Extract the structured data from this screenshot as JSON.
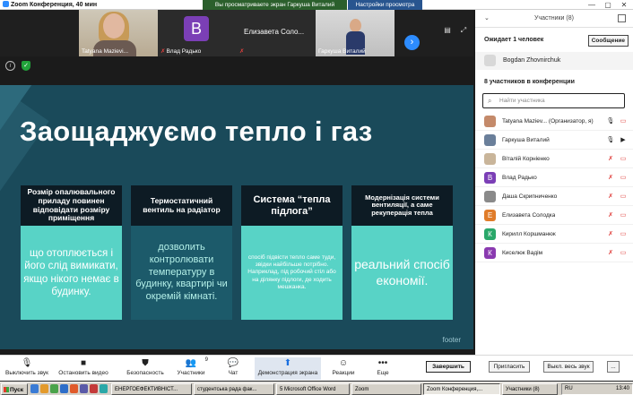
{
  "window": {
    "title": "Zoom Конференция, 40 мин",
    "share_banner": "Вы просматриваете экран Гаркуша Виталий",
    "view_options": "Настройки просмотра",
    "controls": [
      "—",
      "▢",
      "✕"
    ]
  },
  "video_strip": {
    "tiles": [
      {
        "name": "Tatyana Mazievi...",
        "kind": "photo-woman",
        "muted": false
      },
      {
        "name": "Влад Радько",
        "kind": "avatar",
        "letter": "B",
        "color": "#7b3fb6",
        "muted": true
      },
      {
        "name": "Елизавета  Соло...",
        "kind": "name-only",
        "muted": true
      },
      {
        "name": "Гаркуша Виталий",
        "kind": "photo-kid",
        "muted": false
      }
    ],
    "next_icon": "chevron-right-icon"
  },
  "slide": {
    "title": "Заощаджуємо тепло і газ",
    "footer": "footer",
    "cards": [
      {
        "head": "Розмір опалювального приладу повинен відповідати розміру приміщення",
        "body": "що отоплюється і його слід вимикати, якщо нікого немає в будинку."
      },
      {
        "head": "Термостатичний вентиль на радіатор",
        "body": "дозволить контролювати температуру в будинку, квартирі чи окремій кімнаті."
      },
      {
        "head": "Система “тепла підлога”",
        "body": "спосіб підвісти тепло саме туди, звідки найбільше потрібно. Наприклад, під робочий стіл або на ділянку підлоги, де ходить мешканка."
      },
      {
        "head": "Модернізація системи вентиляції, а саме рекуперація тепла",
        "body": "реальний спосіб економії."
      }
    ]
  },
  "toolbar": {
    "mute": "Выключить звук",
    "video": "Остановить видео",
    "security": "Безопасность",
    "participants": "Участники",
    "participants_count": "9",
    "chat": "Чат",
    "share": "Демонстрация экрана",
    "reactions": "Реакции",
    "more": "Еще",
    "end": "Завершить"
  },
  "panel": {
    "title": "Участники (8)",
    "waiting_label": "Ожидает 1 человек",
    "message_btn": "Сообщение",
    "waiting_person": "Bogdan Zhovnirchuk",
    "in_conf_label": "8 участников в конференции",
    "search_placeholder": "Найти участника",
    "participants": [
      {
        "name": "Tatyana Maziev... (Организатор, я)",
        "avatar": "",
        "color": "#c48a6a",
        "mic": "on",
        "video": "off"
      },
      {
        "name": "Гаркуша Виталий",
        "avatar": "",
        "color": "#6a7f9a",
        "mic": "on",
        "video": "on"
      },
      {
        "name": "Віталій Корніенко",
        "avatar": "",
        "color": "#c9b59a",
        "mic": "off",
        "video": "off"
      },
      {
        "name": "Влад Радько",
        "avatar": "В",
        "color": "#7b3fb6",
        "mic": "off",
        "video": "off"
      },
      {
        "name": "Даша Скрипниченко",
        "avatar": "",
        "color": "#8a8a8a",
        "mic": "off",
        "video": "off"
      },
      {
        "name": "Елизавета Солодка",
        "avatar": "Е",
        "color": "#e07c2a",
        "mic": "off",
        "video": "off"
      },
      {
        "name": "Кирилл Коршманюк",
        "avatar": "К",
        "color": "#2aa86a",
        "mic": "off",
        "video": "off"
      },
      {
        "name": "Киселюк Вадім",
        "avatar": "К",
        "color": "#8a3ab0",
        "mic": "off",
        "video": "off"
      }
    ],
    "invite_btn": "Пригласить",
    "mute_all_btn": "Выкл. весь звук",
    "more_btn": "..."
  },
  "taskbar": {
    "start": "Пуск",
    "tasks": [
      "ЕНЕРГОЕФЕКТИВНІСТ...",
      "студентська рада фак...",
      "5 Microsoft Office Word",
      "Zoom",
      "Zoom Конференция,...",
      "Участники (8)"
    ],
    "time": "13:40",
    "lang": "RU"
  }
}
